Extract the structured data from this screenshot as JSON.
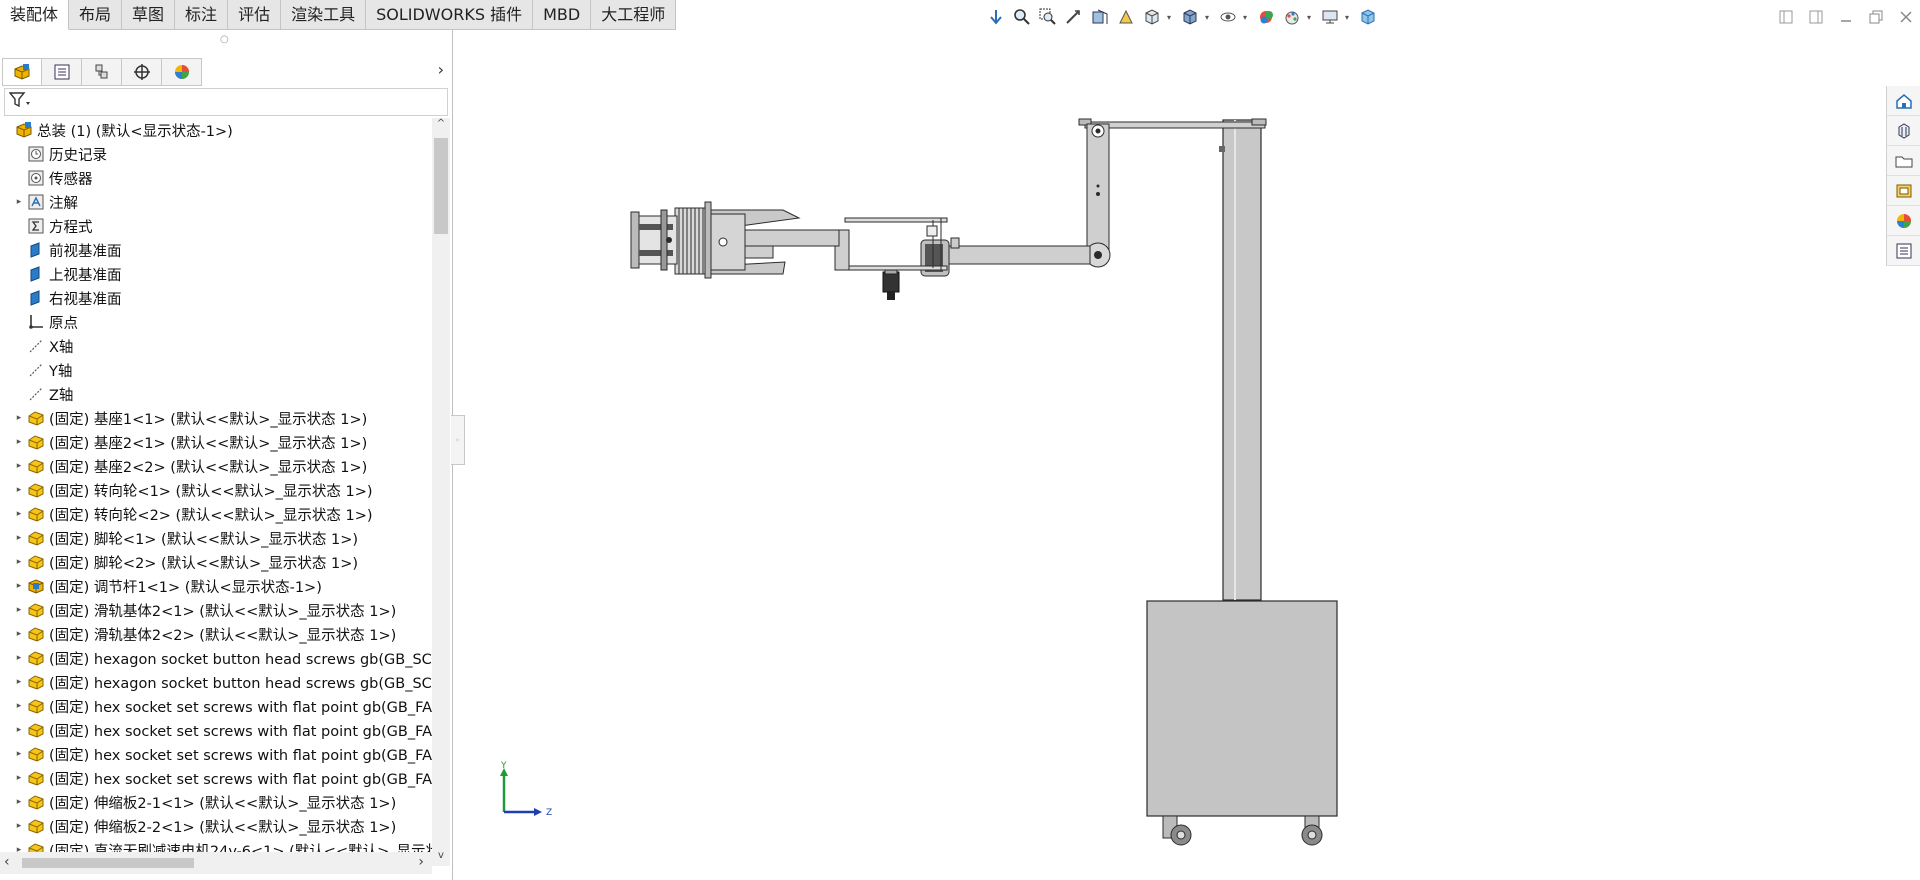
{
  "tabs": [
    {
      "label": "装配体",
      "active": true
    },
    {
      "label": "布局"
    },
    {
      "label": "草图"
    },
    {
      "label": "标注"
    },
    {
      "label": "评估"
    },
    {
      "label": "渲染工具"
    },
    {
      "label": "SOLIDWORKS 插件"
    },
    {
      "label": "MBD"
    },
    {
      "label": "大工程师"
    }
  ],
  "tree": [
    {
      "label": "总装 (1)  (默认<显示状态-1>)",
      "icon": "assembly-icon",
      "arrow": false,
      "indent": 0
    },
    {
      "label": "历史记录",
      "icon": "history-icon",
      "arrow": false,
      "indent": 1
    },
    {
      "label": "传感器",
      "icon": "sensor-icon",
      "arrow": false,
      "indent": 1
    },
    {
      "label": "注解",
      "icon": "annotation-icon",
      "arrow": true,
      "indent": 1
    },
    {
      "label": "方程式",
      "icon": "equation-icon",
      "arrow": false,
      "indent": 1
    },
    {
      "label": "前视基准面",
      "icon": "plane-icon",
      "arrow": false,
      "indent": 1
    },
    {
      "label": "上视基准面",
      "icon": "plane-icon",
      "arrow": false,
      "indent": 1
    },
    {
      "label": "右视基准面",
      "icon": "plane-icon",
      "arrow": false,
      "indent": 1
    },
    {
      "label": "原点",
      "icon": "origin-icon",
      "arrow": false,
      "indent": 1
    },
    {
      "label": "X轴",
      "icon": "axis-icon",
      "arrow": false,
      "indent": 1
    },
    {
      "label": "Y轴",
      "icon": "axis-icon",
      "arrow": false,
      "indent": 1
    },
    {
      "label": "Z轴",
      "icon": "axis-icon",
      "arrow": false,
      "indent": 1
    },
    {
      "label": "(固定) 基座1<1> (默认<<默认>_显示状态 1>)",
      "icon": "part-icon",
      "arrow": true,
      "indent": 1
    },
    {
      "label": "(固定) 基座2<1> (默认<<默认>_显示状态 1>)",
      "icon": "part-icon",
      "arrow": true,
      "indent": 1
    },
    {
      "label": "(固定) 基座2<2> (默认<<默认>_显示状态 1>)",
      "icon": "part-icon",
      "arrow": true,
      "indent": 1
    },
    {
      "label": "(固定) 转向轮<1> (默认<<默认>_显示状态 1>)",
      "icon": "part-icon",
      "arrow": true,
      "indent": 1
    },
    {
      "label": "(固定) 转向轮<2> (默认<<默认>_显示状态 1>)",
      "icon": "part-icon",
      "arrow": true,
      "indent": 1
    },
    {
      "label": "(固定) 脚轮<1> (默认<<默认>_显示状态 1>)",
      "icon": "part-icon",
      "arrow": true,
      "indent": 1
    },
    {
      "label": "(固定) 脚轮<2> (默认<<默认>_显示状态 1>)",
      "icon": "part-icon",
      "arrow": true,
      "indent": 1
    },
    {
      "label": "(固定) 调节杆1<1> (默认<显示状态-1>)",
      "icon": "subassembly-icon",
      "arrow": true,
      "indent": 1
    },
    {
      "label": "(固定) 滑轨基体2<1> (默认<<默认>_显示状态 1>)",
      "icon": "part-icon",
      "arrow": true,
      "indent": 1
    },
    {
      "label": "(固定) 滑轨基体2<2> (默认<<默认>_显示状态 1>)",
      "icon": "part-icon",
      "arrow": true,
      "indent": 1
    },
    {
      "label": "(固定) hexagon socket button head screws gb(GB_SC",
      "icon": "part-icon",
      "arrow": true,
      "indent": 1
    },
    {
      "label": "(固定) hexagon socket button head screws gb(GB_SC",
      "icon": "part-icon",
      "arrow": true,
      "indent": 1
    },
    {
      "label": "(固定) hex socket set screws with flat point gb(GB_FA",
      "icon": "part-icon",
      "arrow": true,
      "indent": 1
    },
    {
      "label": "(固定) hex socket set screws with flat point gb(GB_FA",
      "icon": "part-icon",
      "arrow": true,
      "indent": 1
    },
    {
      "label": "(固定) hex socket set screws with flat point gb(GB_FA",
      "icon": "part-icon",
      "arrow": true,
      "indent": 1
    },
    {
      "label": "(固定) hex socket set screws with flat point gb(GB_FA",
      "icon": "part-icon",
      "arrow": true,
      "indent": 1
    },
    {
      "label": "(固定) 伸缩板2-1<1> (默认<<默认>_显示状态 1>)",
      "icon": "part-icon",
      "arrow": true,
      "indent": 1
    },
    {
      "label": "(固定) 伸缩板2-2<1> (默认<<默认>_显示状态 1>)",
      "icon": "part-icon",
      "arrow": true,
      "indent": 1
    },
    {
      "label": "(固定) 直流无刷减速电机24v-6<1> (默认<<默认>_显示状",
      "icon": "part-icon",
      "arrow": true,
      "indent": 1
    }
  ],
  "triad": {
    "y_label": "Y",
    "z_label": "Z"
  },
  "colors": {
    "part_fill": "#c8c8c8",
    "edge": "#2b2b2b",
    "part_icon": "#f0b400",
    "plane_icon": "#2a7bc8"
  }
}
